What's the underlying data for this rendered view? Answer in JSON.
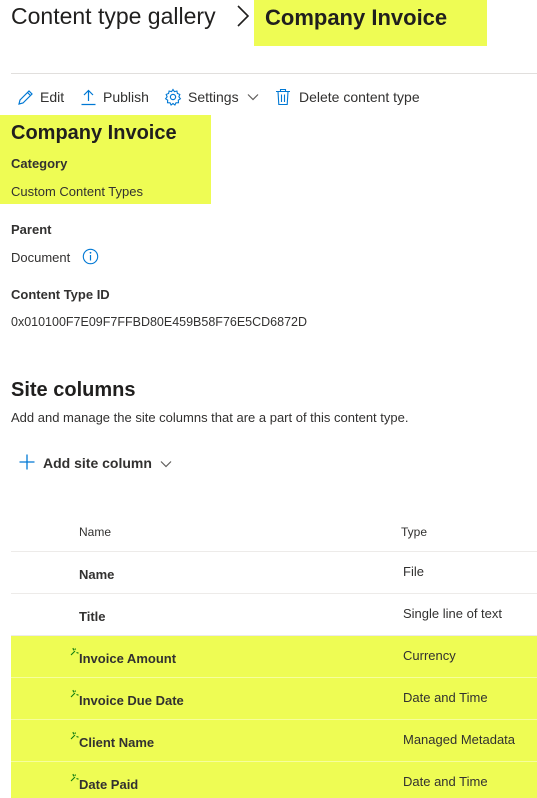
{
  "breadcrumb": {
    "root": "Content type gallery",
    "separator": "〉",
    "current": "Company Invoice"
  },
  "toolbar": {
    "edit": "Edit",
    "publish": "Publish",
    "settings": "Settings",
    "delete": "Delete content type"
  },
  "content_type": {
    "title": "Company Invoice",
    "category_label": "Category",
    "category_value": "Custom Content Types",
    "parent_label": "Parent",
    "parent_value": "Document",
    "id_label": "Content Type ID",
    "id_value": "0x010100F7E09F7FFBD80E459B58F76E5CD6872D"
  },
  "site_columns": {
    "title": "Site columns",
    "description": "Add and manage the site columns that are a part of this content type.",
    "add_label": "Add site column",
    "headers": {
      "name": "Name",
      "type": "Type"
    },
    "rows": [
      {
        "name": "Name",
        "type": "File",
        "new": false
      },
      {
        "name": "Title",
        "type": "Single line of text",
        "new": false
      },
      {
        "name": "Invoice Amount",
        "type": "Currency",
        "new": true
      },
      {
        "name": "Invoice Due Date",
        "type": "Date and Time",
        "new": true
      },
      {
        "name": "Client Name",
        "type": "Managed Metadata",
        "new": true
      },
      {
        "name": "Date Paid",
        "type": "Date and Time",
        "new": true
      }
    ]
  },
  "colors": {
    "highlight": "#eefc54",
    "text": "#323130",
    "accent": "#0078d4",
    "new_indicator": "#107c10"
  },
  "icons": {
    "edit": "pencil-icon",
    "publish": "upload-icon",
    "settings": "gear-icon",
    "delete": "trash-icon",
    "info": "info-icon",
    "add": "plus-icon",
    "chevron": "chevron-down-icon",
    "new": "new-item-sparkle-icon"
  }
}
